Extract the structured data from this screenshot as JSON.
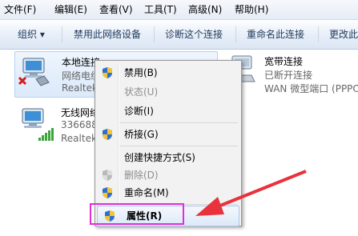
{
  "menubar": [
    {
      "label": "文件(F)"
    },
    {
      "label": "编辑(E)"
    },
    {
      "label": "查看(V)"
    },
    {
      "label": "工具(T)"
    },
    {
      "label": "高级(N)"
    },
    {
      "label": "帮助(H)"
    }
  ],
  "toolbar": {
    "organize": "组织 ▾",
    "disable": "禁用此网络设备",
    "diagnose": "诊断这个连接",
    "rename": "重命名此连接",
    "change": "更改此"
  },
  "connections": {
    "local": {
      "name": "本地连接",
      "line2": "网络电缆",
      "line3": "Realtek"
    },
    "broadband": {
      "name": "宽带连接",
      "line2": "已断开连接",
      "line3": "WAN 微型端口 (PPPO"
    },
    "wireless": {
      "name": "无线网络",
      "line2": "336688",
      "line3": "Realtek"
    }
  },
  "context_menu": {
    "items": [
      {
        "label": "禁用(B)",
        "icon": "shield-icon",
        "disabled": false
      },
      {
        "label": "状态(U)",
        "icon": "",
        "disabled": true
      },
      {
        "label": "诊断(I)",
        "icon": "",
        "disabled": false
      },
      {
        "label": "桥接(G)",
        "icon": "shield-icon",
        "disabled": false
      },
      {
        "label": "创建快捷方式(S)",
        "icon": "",
        "disabled": false
      },
      {
        "label": "删除(D)",
        "icon": "shield-icon",
        "disabled": true
      },
      {
        "label": "重命名(M)",
        "icon": "shield-icon",
        "disabled": false
      },
      {
        "label": "属性(R)",
        "icon": "shield-icon",
        "disabled": false,
        "highlighted": true
      }
    ]
  },
  "colors": {
    "highlight_box": "#e02edb",
    "arrow": "#e8323c"
  }
}
